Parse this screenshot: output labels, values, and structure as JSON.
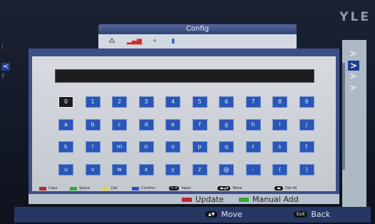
{
  "header": {
    "title": "Config",
    "brand": "YLE"
  },
  "icons": [
    "network-icon",
    "signal-icon",
    "satellite-icon",
    "card-icon"
  ],
  "keyboard": {
    "input_value": "",
    "rows": [
      [
        "0",
        "1",
        "2",
        "3",
        "4",
        "5",
        "6",
        "7",
        "8",
        "9"
      ],
      [
        "a",
        "b",
        "c",
        "d",
        "e",
        "f",
        "g",
        "h",
        "i",
        "j"
      ],
      [
        "k",
        "l",
        "m",
        "n",
        "o",
        "p",
        "q",
        "r",
        "s",
        "t"
      ],
      [
        "u",
        "v",
        "w",
        "x",
        "y",
        "z",
        "@",
        "-",
        "(",
        ")"
      ]
    ],
    "selected": "0"
  },
  "legend": {
    "caps": "Caps",
    "space": "Space",
    "del": "Del",
    "confirm": "Confirm",
    "input_key": "0~9",
    "input": "Input",
    "move_key": "",
    "move": "Move",
    "delall_key": "",
    "delall": "Del All",
    "colors": {
      "red": "#c0262f",
      "green": "#3aa53a",
      "yellow": "#e6d24a",
      "blue": "#2a4fc0"
    }
  },
  "buttons": {
    "update": "Update",
    "manual_add": "Manual Add"
  },
  "footer": {
    "move_key": "",
    "move": "Move",
    "exit_key": "Exit",
    "back": "Back"
  },
  "sidebar": {
    "arrows": [
      ">",
      ">",
      ">",
      ">"
    ]
  }
}
